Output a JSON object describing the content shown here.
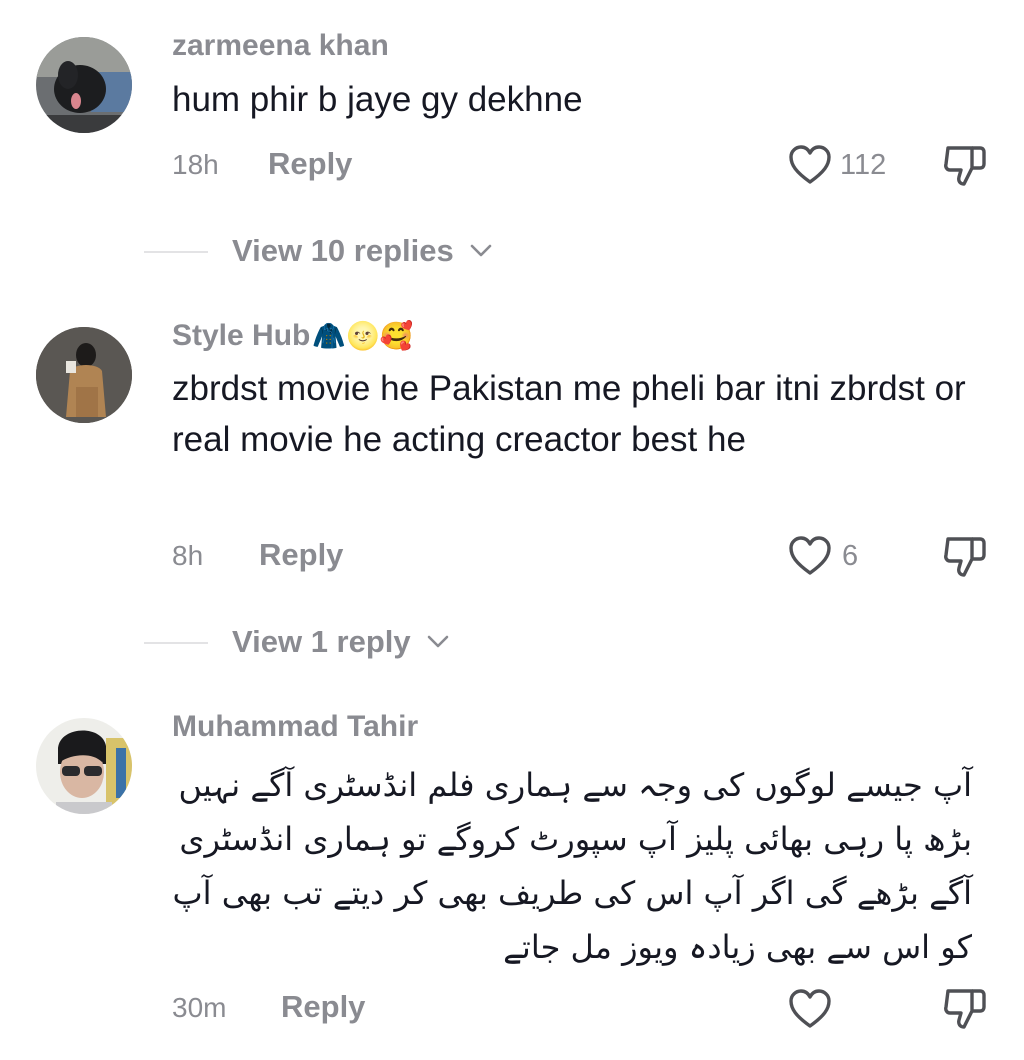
{
  "comments": [
    {
      "username": "zarmeena khan",
      "username_emoji": "",
      "text": "hum phir b jaye gy dekhne",
      "time": "18h",
      "reply_label": "Reply",
      "likes": "112",
      "view_replies": "View 10 replies"
    },
    {
      "username": "Style Hub",
      "username_emoji": "🧥🌝🥰",
      "text": "zbrdst movie he Pakistan me pheli bar itni zbrdst or real movie he acting creactor best he",
      "time": "8h",
      "reply_label": "Reply",
      "likes": "6",
      "view_replies": "View 1 reply"
    },
    {
      "username": "Muhammad Tahir",
      "username_emoji": "",
      "text": "آپ جیسے لوگوں کی وجہ سے ہماری فلم انڈسٹری آگے نہیں بڑھ پا رہی بھائی پلیز آپ سپورٹ کروگے تو ہماری انڈسٹری آگے بڑھے گی اگر آپ اس کی طریف بھی کر دیتے تب بھی آپ کو اس سے بھی زیادہ ویوز مل جاتے",
      "time": "30m",
      "reply_label": "Reply",
      "likes": ""
    }
  ],
  "icons": {
    "like": "heart-outline-icon",
    "dislike": "thumbs-down-icon",
    "expand": "chevron-down-icon"
  },
  "colors": {
    "text_primary": "#161823",
    "text_secondary": "#8a8b91",
    "divider": "#e3e3e5"
  }
}
